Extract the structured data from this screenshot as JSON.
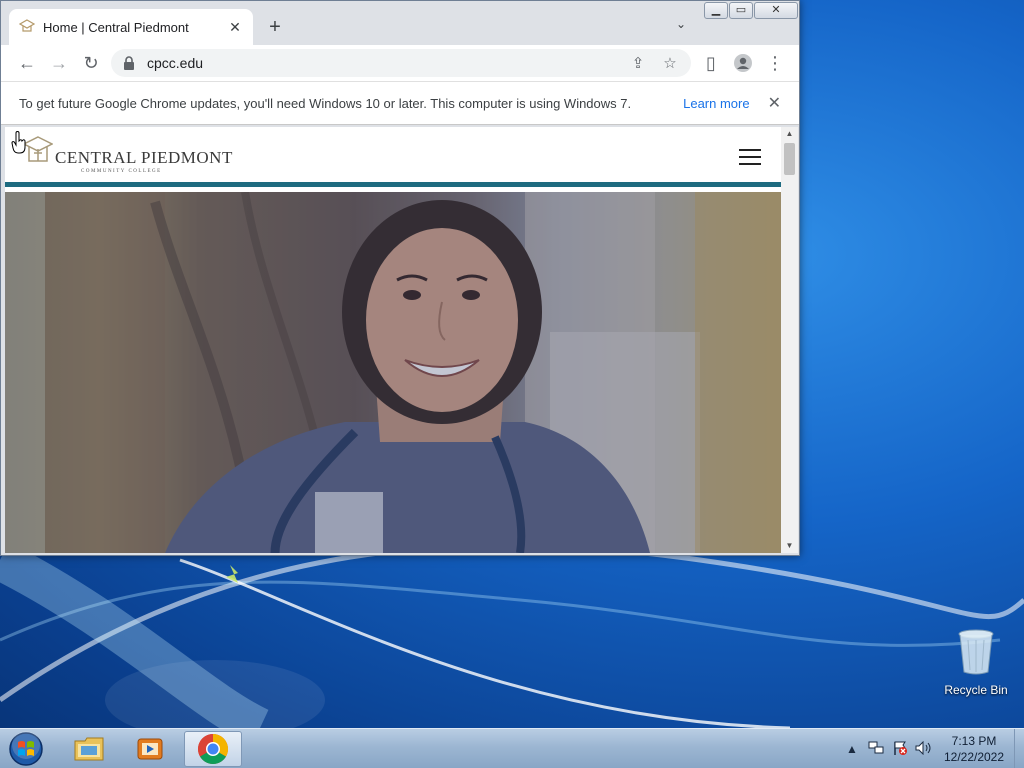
{
  "browser": {
    "tab": {
      "title": "Home | Central Piedmont",
      "close_glyph": "✕"
    },
    "new_tab_glyph": "+",
    "tab_search_glyph": "⌄",
    "window_controls": {
      "minimize": "▁",
      "maximize": "▭",
      "close": "✕"
    },
    "nav": {
      "back": "←",
      "forward": "→",
      "reload": "↻"
    },
    "address": {
      "url": "cpcc.edu"
    },
    "toolbar_icons": {
      "share": "⇪",
      "bookmark": "☆",
      "side_panel": "▯",
      "profile": "●",
      "menu": "⋮"
    },
    "infobar": {
      "message": "To get future Google Chrome updates, you'll need Windows 10 or later. This computer is using Windows 7.",
      "learn_more": "Learn more",
      "close_glyph": "✕"
    }
  },
  "site": {
    "logo_name": "CENTRAL PIEDMONT",
    "logo_sub": "COMMUNITY COLLEGE",
    "brand_color": "#1e6b80"
  },
  "scrollbar": {
    "up": "▲",
    "down": "▼"
  },
  "desktop": {
    "recycle_bin_label": "Recycle Bin"
  },
  "taskbar": {
    "clock_time": "7:13 PM",
    "clock_date": "12/22/2022",
    "tray_expand": "▲"
  }
}
